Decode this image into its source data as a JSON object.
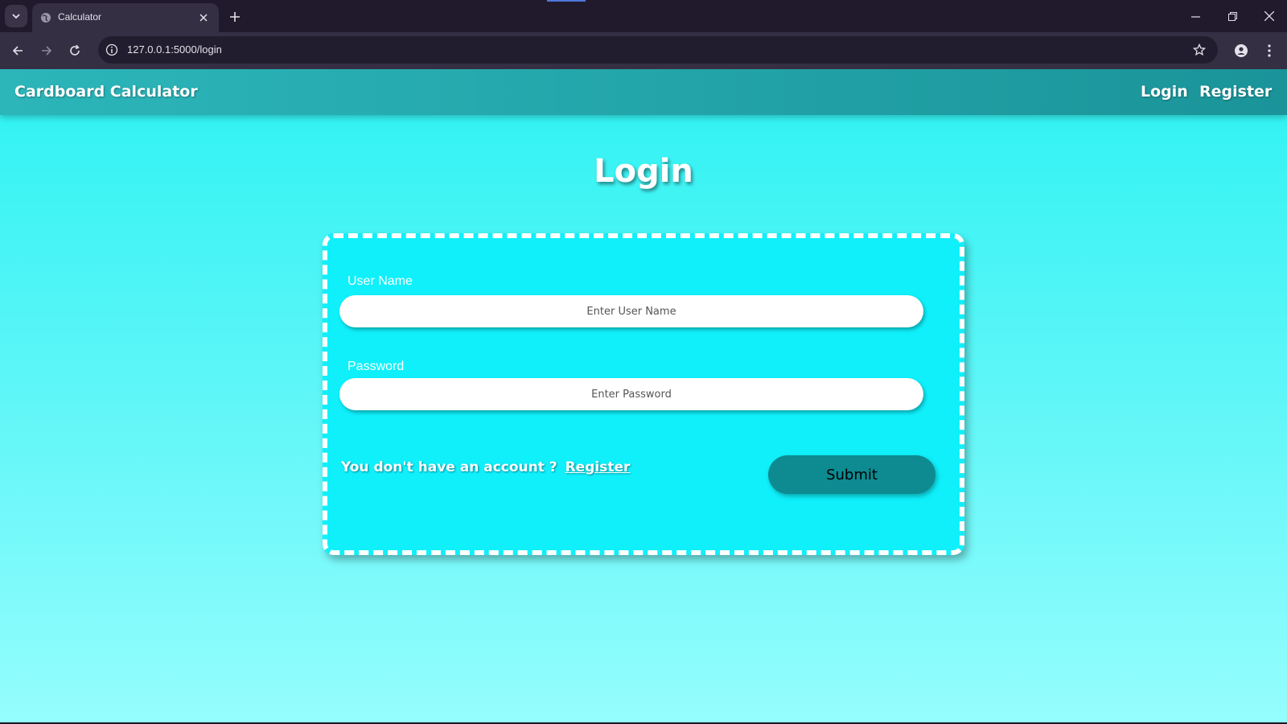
{
  "browser": {
    "tab_title": "Calculator",
    "url": "127.0.0.1:5000/login",
    "icons": {
      "tab_menu": "chevron-down-icon",
      "favicon": "globe-icon",
      "tab_close": "close-icon",
      "new_tab": "plus-icon",
      "back": "arrow-left-icon",
      "forward": "arrow-right-icon",
      "reload": "reload-icon",
      "site_info": "info-icon",
      "bookmark": "star-icon",
      "profile": "person-icon",
      "menu": "kebab-menu-icon",
      "minimize": "minimize-icon",
      "restore": "restore-icon",
      "close": "close-icon"
    }
  },
  "navbar": {
    "brand": "Cardboard Calculator",
    "links": [
      {
        "label": "Login"
      },
      {
        "label": "Register"
      }
    ]
  },
  "page": {
    "title": "Login",
    "form": {
      "username_label": "User Name",
      "username_placeholder": "Enter User Name",
      "password_label": "Password",
      "password_placeholder": "Enter Password",
      "account_prompt": "You don't have an account ?",
      "register_link": "Register",
      "submit_label": "Submit"
    }
  },
  "colors": {
    "page_top": "#2df2f2",
    "page_bottom": "#95fdfd",
    "navbar": "#1a9499",
    "card": "#0ff0fb",
    "submit": "#0d8b91"
  }
}
